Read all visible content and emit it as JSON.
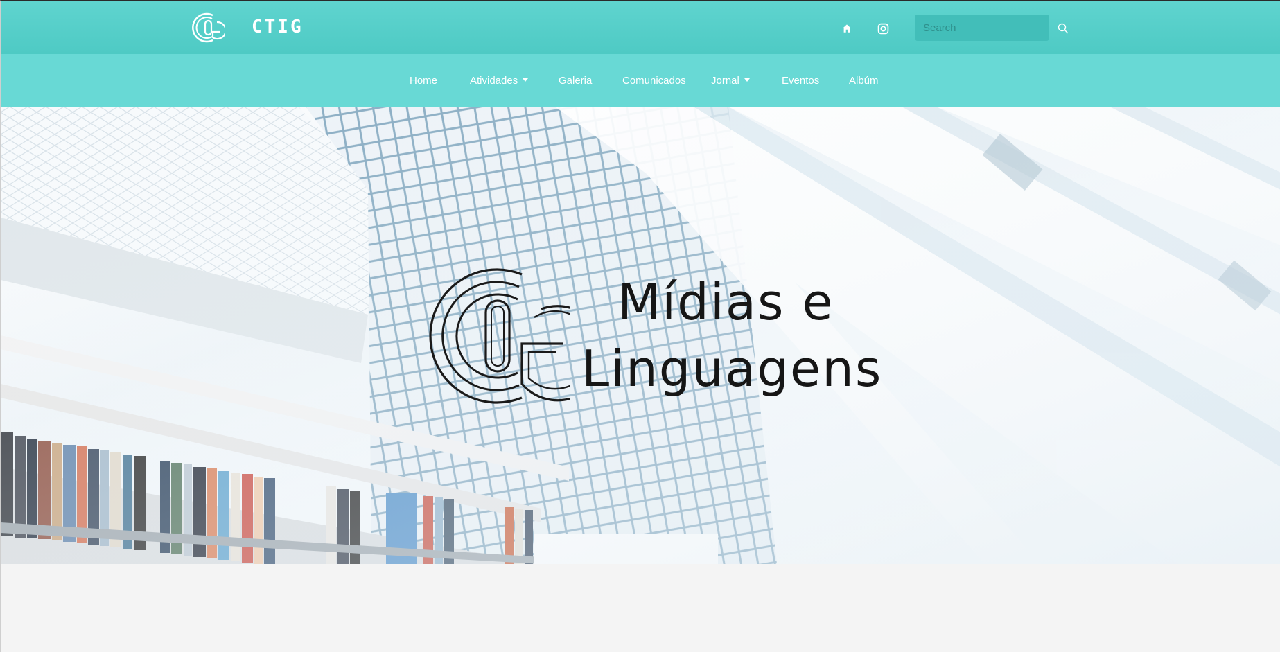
{
  "header": {
    "brand_name": "CTIG",
    "logo_icon": "ctig-logo-icon",
    "home_icon": "home-icon",
    "instagram_icon": "instagram-icon",
    "search_placeholder": "Search",
    "search_value": "",
    "search_icon": "search-icon"
  },
  "nav": {
    "items": [
      {
        "label": "Home",
        "dropdown": false
      },
      {
        "label": "Atividades",
        "dropdown": true
      },
      {
        "label": "Galeria",
        "dropdown": false
      },
      {
        "label": "Comunicados",
        "dropdown": false
      },
      {
        "label": "Jornal",
        "dropdown": true
      },
      {
        "label": "Eventos",
        "dropdown": false
      },
      {
        "label": "Albúm",
        "dropdown": false
      }
    ]
  },
  "hero": {
    "title_line1": "Mídias e",
    "title_line2": "Linguagens",
    "logo_icon": "ctig-logo-icon"
  },
  "colors": {
    "topbar": "#4ecac4",
    "navbar": "#68d9d5",
    "search_bg": "#42beb9",
    "page_bg": "#f4f4f4",
    "hero_text": "#161616"
  }
}
